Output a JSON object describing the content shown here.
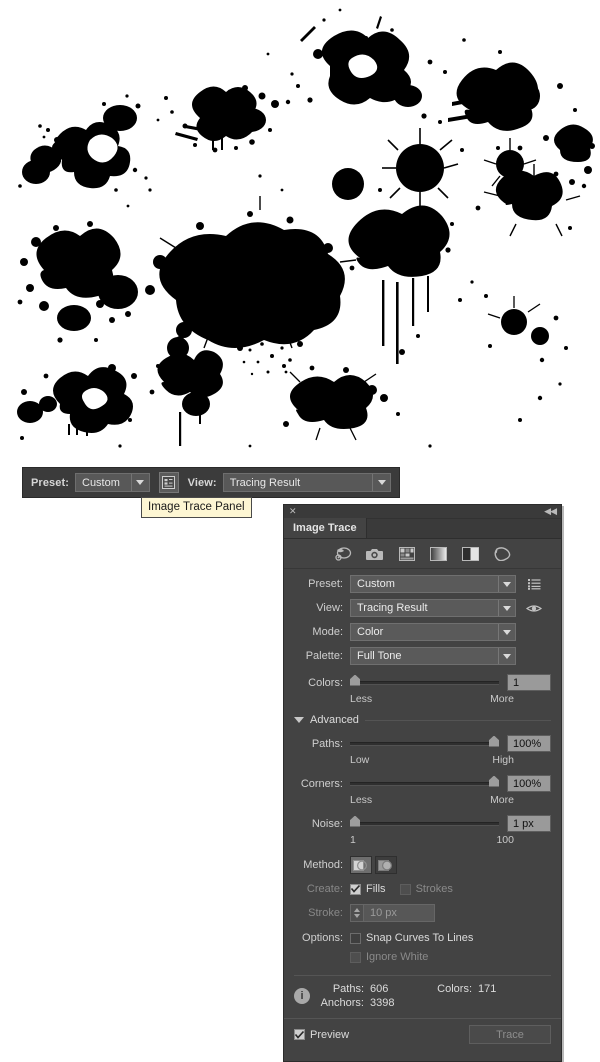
{
  "artwork": {
    "name": "ink-splatter-artwork",
    "background": "#ffffff",
    "ink_color": "#000000"
  },
  "control_bar": {
    "preset_label": "Preset:",
    "preset_value": "Custom",
    "panel_button_icon": "image-trace-panel-icon",
    "view_label": "View:",
    "view_value": "Tracing Result"
  },
  "tooltip": {
    "text": "Image Trace Panel"
  },
  "panel": {
    "close_icon": "✕",
    "collapse_icon": "◀◀",
    "tab_label": "Image Trace",
    "toolbar_icons": [
      "auto-color-icon",
      "high-fidelity-photo-icon",
      "low-fidelity-photo-icon",
      "grayscale-icon",
      "black-and-white-icon",
      "outline-icon"
    ],
    "preset": {
      "label": "Preset:",
      "value": "Custom",
      "trail_icon": "menu-list-icon"
    },
    "view": {
      "label": "View:",
      "value": "Tracing Result",
      "trail_icon": "eye-icon"
    },
    "mode": {
      "label": "Mode:",
      "value": "Color"
    },
    "palette": {
      "label": "Palette:",
      "value": "Full Tone"
    },
    "colors": {
      "label": "Colors:",
      "value": "1",
      "min_label": "Less",
      "max_label": "More",
      "percent": 0
    },
    "advanced": {
      "label": "Advanced",
      "expanded": true
    },
    "paths": {
      "label": "Paths:",
      "value": "100%",
      "min_label": "Low",
      "max_label": "High",
      "percent": 100
    },
    "corners": {
      "label": "Corners:",
      "value": "100%",
      "min_label": "Less",
      "max_label": "More",
      "percent": 100
    },
    "noise": {
      "label": "Noise:",
      "value": "1 px",
      "min_label": "1",
      "max_label": "100",
      "percent": 0
    },
    "method": {
      "label": "Method:",
      "options": [
        "abutting-method-icon",
        "overlapping-method-icon"
      ],
      "selected_index": 0
    },
    "create": {
      "label": "Create:",
      "fills_label": "Fills",
      "fills_checked": true,
      "strokes_label": "Strokes",
      "strokes_checked": false
    },
    "stroke": {
      "label": "Stroke:",
      "value": "10 px",
      "disabled": true
    },
    "options": {
      "label": "Options:",
      "snap_label": "Snap Curves To Lines",
      "snap_checked": false,
      "ignore_white_label": "Ignore White",
      "ignore_white_checked": false,
      "ignore_white_disabled": true
    },
    "info": {
      "icon": "i",
      "paths_label": "Paths:",
      "paths_value": "606",
      "colors_label": "Colors:",
      "colors_value": "171",
      "anchors_label": "Anchors:",
      "anchors_value": "3398"
    },
    "footer": {
      "preview_label": "Preview",
      "preview_checked": true,
      "trace_label": "Trace",
      "trace_disabled": true
    }
  },
  "colors": {
    "panel_bg": "#434343",
    "panel_titlebar": "#3a3a3a",
    "field_bg": "#5a5a5a",
    "text": "#dcdcdc",
    "tooltip_bg": "#fdf6d3",
    "accent_black": "#000000"
  }
}
